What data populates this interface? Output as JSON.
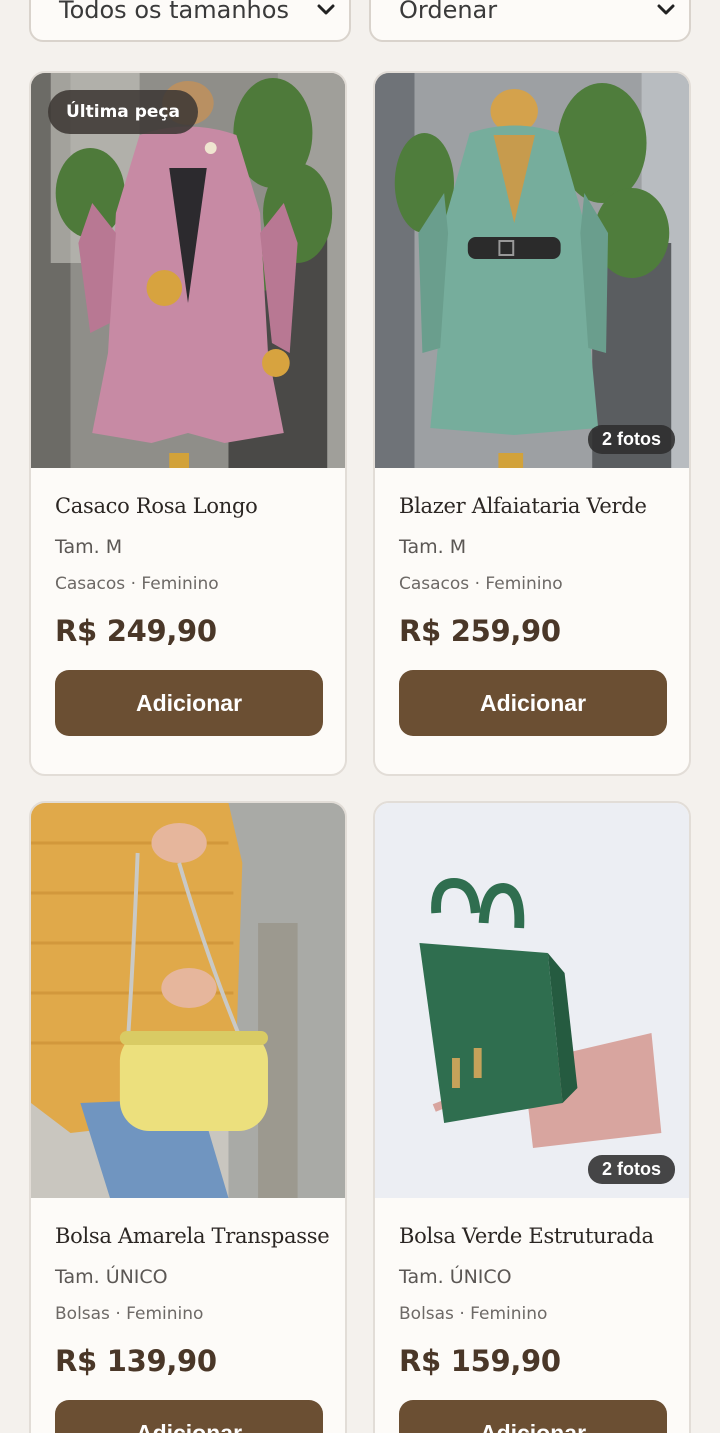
{
  "filters": {
    "size_select": "Todos os tamanhos",
    "sort_select": "Ordenar"
  },
  "products": [
    {
      "name": "Casaco Rosa Longo",
      "size": "Tam. M",
      "category": "Casacos",
      "gender": "Feminino",
      "separator": "·",
      "price": "R$ 249,90",
      "badge": "Última peça",
      "add_label": "Adicionar",
      "color": "#c78aa4"
    },
    {
      "name": "Blazer Alfaiataria Verde",
      "size": "Tam. M",
      "category": "Casacos",
      "gender": "Feminino",
      "separator": "·",
      "price": "R$ 259,90",
      "photos_badge": "2 fotos",
      "add_label": "Adicionar",
      "color": "#76ad9c"
    },
    {
      "name": "Bolsa Amarela Transpasse",
      "size": "Tam. ÚNICO",
      "category": "Bolsas",
      "gender": "Feminino",
      "separator": "·",
      "price": "R$ 139,90",
      "add_label": "Adicionar",
      "color": "#ece07d"
    },
    {
      "name": "Bolsa Verde Estruturada",
      "size": "Tam. ÚNICO",
      "category": "Bolsas",
      "gender": "Feminino",
      "separator": "·",
      "price": "R$ 159,90",
      "photos_badge": "2 fotos",
      "add_label": "Adicionar",
      "color": "#2f6e4f"
    }
  ],
  "colors": {
    "accent": "#6b4f33",
    "price": "#4a3728",
    "background": "#f4f1ed"
  }
}
